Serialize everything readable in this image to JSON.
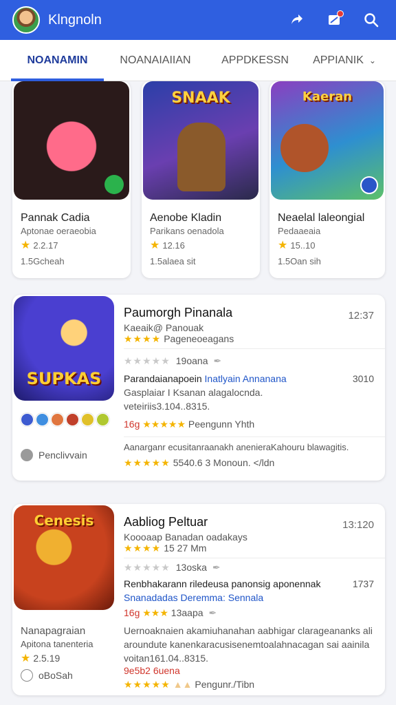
{
  "appbar": {
    "title": "Klngnoln",
    "icons": [
      "avatar",
      "share-icon",
      "notifications-icon",
      "search-icon"
    ],
    "color": "#2f5fe0"
  },
  "tabs": [
    {
      "label": "NOANAMIN",
      "active": true
    },
    {
      "label": "NOANAIAIIAN",
      "active": false
    },
    {
      "label": "APPDKESSN",
      "active": false
    },
    {
      "label": "APPIANIK",
      "active": false,
      "dropdown": true
    }
  ],
  "featured": [
    {
      "tile_text": "",
      "name": "Pannak Cadia",
      "developer": "Aptonae oeraeobia",
      "rating": "2.2.17",
      "size": "1.5Gcheah"
    },
    {
      "tile_text": "SNAAK",
      "name": "Aenobe Kladin",
      "developer": "Parikans oenadola",
      "rating": "12.16",
      "size": "1.5alaea sit"
    },
    {
      "tile_text": "Kaeran",
      "name": "Neaelal laleongial",
      "developer": "Pedaaeaia",
      "rating": "15..10",
      "size": "1.5Oan sih"
    }
  ],
  "list": [
    {
      "tile_text": "SUPKAS",
      "title": "Paumorgh Pinanala",
      "time": "12:37",
      "subtitle": "Kaeaik@ Panouak",
      "subtitle_stars": "★★★★",
      "subtitle_meta": "Pageneoeagans",
      "reviews": "19oana",
      "desc_dark": "Parandaianapoein",
      "desc_blue": "Inatlyain Annanana",
      "desc_num": "3010",
      "line2": "Gasplaiar I Ksanan alagalocnda.",
      "line3": "veteiriis3.104..8315.",
      "rank": "16g",
      "rank_meta": "Peengunn Yhth",
      "status": "Penclivvain",
      "footer": "Aanarganr ecusitanraanakh anenieraKahouru blawagitis.",
      "footer_meta": "5540.6 3 Monoun. </ldn"
    },
    {
      "tile_text": "Cenesis",
      "title": "Aabliog Peltuar",
      "time": "13:120",
      "subtitle": "Koooaap Banadan oadakays",
      "subtitle_stars": "★★★★",
      "subtitle_meta": "15 27 Mm",
      "reviews": "13oska",
      "desc_dark": "Renbhakarann  riledeusa panonsig aponennak",
      "desc_num": "1737",
      "desc_blue": "Snanadadas Deremma: Sennala",
      "rank": "16g",
      "rank_meta": "13aapa",
      "small_name": "Nanapagraian",
      "small_dev": "Apitona tanenteria",
      "small_rating": "2.5.19",
      "small_size": "oBoSah",
      "line2": "Uernoaknaien akamiuhanahan aabhigar clarageananks ali",
      "line3": "aroundute kanenkaracusisenemtoalahnacagan sai aainila",
      "line4": "voitan161.04..8315.",
      "rank_red": "9e5b2 6uena",
      "footer_meta": "Pengunr./Tibn"
    }
  ],
  "colors": {
    "accent": "#2f5fe0",
    "star": "#f4b400",
    "link": "#1f55c8",
    "red": "#d0352b"
  }
}
